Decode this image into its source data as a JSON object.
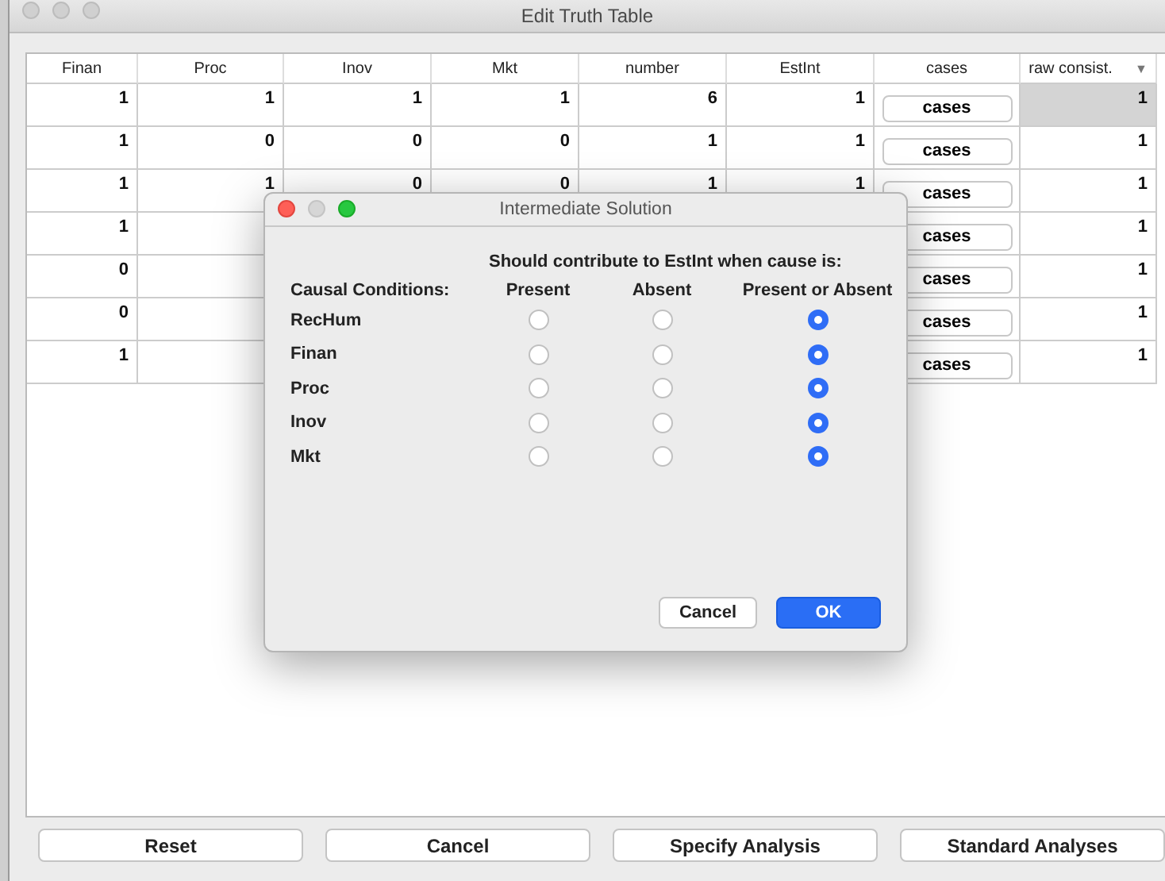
{
  "window": {
    "title": "Edit Truth Table"
  },
  "table": {
    "columns": [
      {
        "label": "Finan"
      },
      {
        "label": "Proc"
      },
      {
        "label": "Inov"
      },
      {
        "label": "Mkt"
      },
      {
        "label": "number"
      },
      {
        "label": "EstInt"
      },
      {
        "label": "cases"
      },
      {
        "label": "raw consist.",
        "sort_indicator": "▼"
      }
    ],
    "rows": [
      {
        "cells": [
          "1",
          "1",
          "1",
          "1",
          "6",
          "1"
        ],
        "cases_button": "cases",
        "raw_consist": "1",
        "selected": true
      },
      {
        "cells": [
          "1",
          "0",
          "0",
          "0",
          "1",
          "1"
        ],
        "cases_button": "cases",
        "raw_consist": "1",
        "selected": false
      },
      {
        "cells": [
          "1",
          "1",
          "0",
          "0",
          "1",
          "1"
        ],
        "cases_button": "cases",
        "raw_consist": "1",
        "selected": false
      },
      {
        "cells": [
          "1",
          null,
          null,
          null,
          null,
          null
        ],
        "cases_button": "cases",
        "raw_consist": "1",
        "selected": false
      },
      {
        "cells": [
          "0",
          null,
          null,
          null,
          null,
          null
        ],
        "cases_button": "cases",
        "raw_consist": "1",
        "selected": false
      },
      {
        "cells": [
          "0",
          null,
          null,
          null,
          null,
          null
        ],
        "cases_button": "cases",
        "raw_consist": "1",
        "selected": false
      },
      {
        "cells": [
          "1",
          null,
          null,
          null,
          null,
          null
        ],
        "cases_button": "cases",
        "raw_consist": "1",
        "selected": false
      }
    ]
  },
  "buttons": [
    "Reset",
    "Cancel",
    "Specify Analysis",
    "Standard Analyses"
  ],
  "dialog": {
    "title": "Intermediate Solution",
    "heading": "Should contribute to EstInt when cause is:",
    "columns": [
      "Causal Conditions:",
      "Present",
      "Absent",
      "Present or Absent"
    ],
    "conditions": [
      {
        "name": "RecHum",
        "options": [
          {
            "selected": false
          },
          {
            "selected": false
          },
          {
            "selected": true
          }
        ]
      },
      {
        "name": "Finan",
        "options": [
          {
            "selected": false
          },
          {
            "selected": false
          },
          {
            "selected": true
          }
        ]
      },
      {
        "name": "Proc",
        "options": [
          {
            "selected": false
          },
          {
            "selected": false
          },
          {
            "selected": true
          }
        ]
      },
      {
        "name": "Inov",
        "options": [
          {
            "selected": false
          },
          {
            "selected": false
          },
          {
            "selected": true
          }
        ]
      },
      {
        "name": "Mkt",
        "options": [
          {
            "selected": false
          },
          {
            "selected": false
          },
          {
            "selected": true
          }
        ]
      }
    ],
    "buttons": [
      {
        "label": "Cancel",
        "kind": "secondary"
      },
      {
        "label": "OK",
        "kind": "primary"
      }
    ]
  }
}
